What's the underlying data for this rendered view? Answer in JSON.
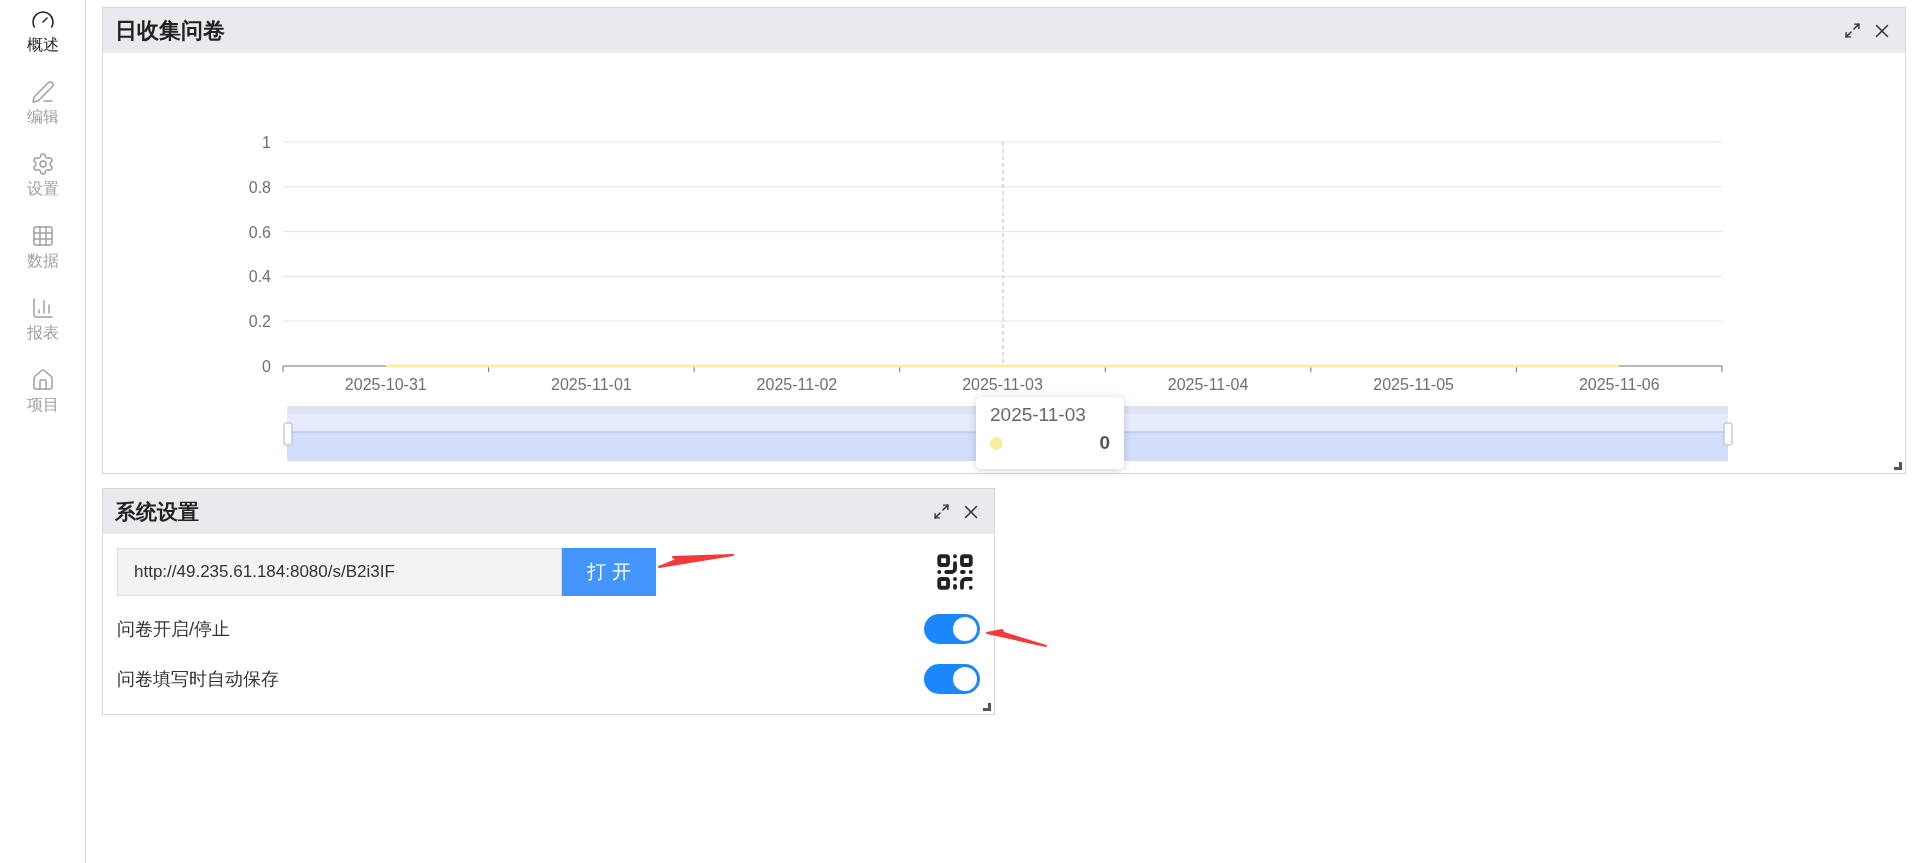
{
  "sidebar": {
    "items": [
      {
        "label": "概述",
        "selected": true
      },
      {
        "label": "编辑",
        "selected": false
      },
      {
        "label": "设置",
        "selected": false
      },
      {
        "label": "数据",
        "selected": false
      },
      {
        "label": "报表",
        "selected": false
      },
      {
        "label": "项目",
        "selected": false
      }
    ]
  },
  "chart_panel": {
    "title": "日收集问卷",
    "chart_data": {
      "type": "line",
      "categories": [
        "2025-10-31",
        "2025-11-01",
        "2025-11-02",
        "2025-11-03",
        "2025-11-04",
        "2025-11-05",
        "2025-11-06"
      ],
      "series": [
        {
          "color": "#f7ef9f",
          "values": [
            0,
            0,
            0,
            0,
            0,
            0,
            0
          ]
        }
      ],
      "ylim": [
        0,
        1
      ],
      "yticks": [
        0,
        0.2,
        0.4,
        0.6,
        0.8,
        1
      ],
      "grid": true
    },
    "tooltip": {
      "title": "2025-11-03",
      "value": "0"
    }
  },
  "settings_panel": {
    "title": "系统设置",
    "url_field": {
      "value": "http://49.235.61.184:8080/s/B2i3IF"
    },
    "open_button": "打 开",
    "toggles": [
      {
        "label": "问卷开启/停止",
        "on": true
      },
      {
        "label": "问卷填写时自动保存",
        "on": true
      }
    ]
  }
}
